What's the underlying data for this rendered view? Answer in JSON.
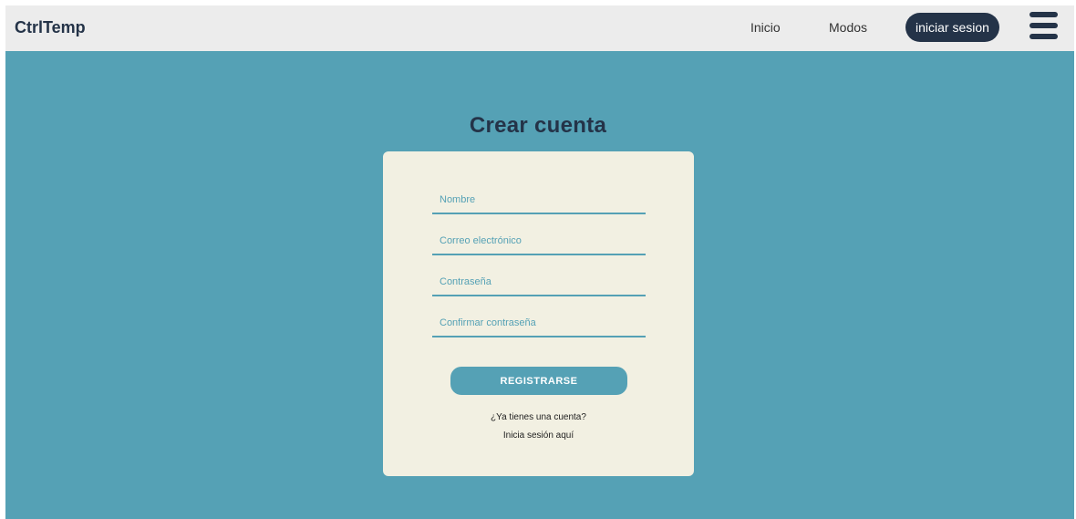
{
  "navbar": {
    "brand": "CtrlTemp",
    "links": [
      "Inicio",
      "Modos"
    ],
    "login_label": "iniciar sesion",
    "menu_icon": "hamburger-menu-icon"
  },
  "main": {
    "title": "Crear cuenta"
  },
  "form": {
    "name_placeholder": "Nombre",
    "email_placeholder": "Correo electrónico",
    "password_placeholder": "Contraseña",
    "confirm_placeholder": "Confirmar contraseña",
    "submit_label": "REGISTRARSE",
    "have_account": "¿Ya tienes una cuenta?",
    "login_link": "Inicia sesión aquí"
  },
  "colors": {
    "background": "#55a1b5",
    "navbar": "#ececec",
    "dark": "#243348",
    "card": "#f2f0e2"
  }
}
